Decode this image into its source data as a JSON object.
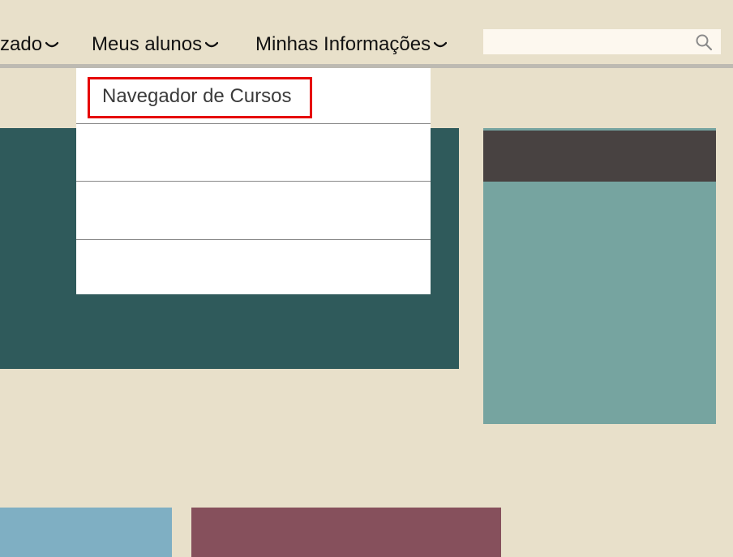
{
  "nav": {
    "items": [
      {
        "label": "zado"
      },
      {
        "label": "Meus alunos"
      },
      {
        "label": "Minhas Informações"
      }
    ],
    "search": {
      "placeholder": "",
      "value": ""
    }
  },
  "dropdown": {
    "items": [
      {
        "label": "Navegador de Cursos"
      },
      {
        "label": ""
      },
      {
        "label": ""
      },
      {
        "label": ""
      }
    ]
  },
  "colors": {
    "background": "#e8e0ca",
    "tile_dark_green": "#2f5a5b",
    "tile_side": "#76a4a0",
    "tile_side_header": "#484241",
    "tile_blue": "#7fafc3",
    "tile_maroon": "#86505c",
    "highlight": "#e60000"
  }
}
